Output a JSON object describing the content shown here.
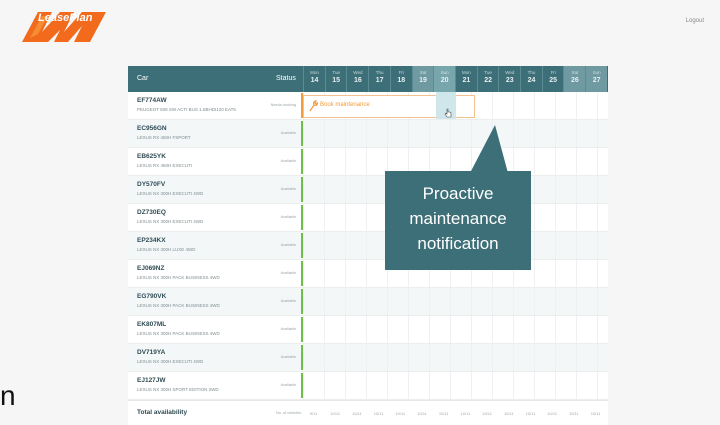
{
  "header": {
    "logo_text": "LeasePlan",
    "logout": "Logout"
  },
  "stray_text": "n",
  "table": {
    "car_header": "Car",
    "status_header": "Status",
    "days": [
      {
        "name": "Mon",
        "date": "14",
        "type": "weekday"
      },
      {
        "name": "Tue",
        "date": "15",
        "type": "weekday"
      },
      {
        "name": "Wed",
        "date": "16",
        "type": "weekday"
      },
      {
        "name": "Thu",
        "date": "17",
        "type": "weekday"
      },
      {
        "name": "Fri",
        "date": "18",
        "type": "weekday"
      },
      {
        "name": "Sat",
        "date": "19",
        "type": "weekend"
      },
      {
        "name": "Sun",
        "date": "20",
        "type": "today"
      },
      {
        "name": "Mon",
        "date": "21",
        "type": "weekday"
      },
      {
        "name": "Tue",
        "date": "22",
        "type": "weekday"
      },
      {
        "name": "Wed",
        "date": "23",
        "type": "weekday"
      },
      {
        "name": "Thu",
        "date": "24",
        "type": "weekday"
      },
      {
        "name": "Fri",
        "date": "25",
        "type": "weekday"
      },
      {
        "name": "Sat",
        "date": "26",
        "type": "weekend"
      },
      {
        "name": "Sun",
        "date": "27",
        "type": "weekend"
      }
    ],
    "rows": [
      {
        "plate": "EF774AW",
        "model": "PEUGEOT 508 SW ACTI BUS 1.6BHDI120 EAT6",
        "status": "Needs booking",
        "bar": "orange"
      },
      {
        "plate": "EC956GN",
        "model": "LEXUS RX 450H FSPORT",
        "status": "Available",
        "bar": "green"
      },
      {
        "plate": "EB625YK",
        "model": "LEXUS RX 450H EXECUTI",
        "status": "Available",
        "bar": "green"
      },
      {
        "plate": "DY570FV",
        "model": "LEXUS NX 300H EXECUTI 4WD",
        "status": "Available",
        "bar": "green"
      },
      {
        "plate": "DZ730EQ",
        "model": "LEXUS NX 300H EXECUTI 4WD",
        "status": "Available",
        "bar": "green"
      },
      {
        "plate": "EP234KX",
        "model": "LEXUS NX 300H LUXE 4WD",
        "status": "Available",
        "bar": "green"
      },
      {
        "plate": "EJ069NZ",
        "model": "LEXUS NX 300H PACK BUSINESS 4WD",
        "status": "Available",
        "bar": "green"
      },
      {
        "plate": "EG790VK",
        "model": "LEXUS NX 300H PACK BUSINESS 4WD",
        "status": "Available",
        "bar": "green"
      },
      {
        "plate": "EK807ML",
        "model": "LEXUS NX 300H PACK BUSINESS 4WD",
        "status": "Available",
        "bar": "green"
      },
      {
        "plate": "DV719YA",
        "model": "LEXUS NX 300H EXECUTI 4WD",
        "status": "Available",
        "bar": "green"
      },
      {
        "plate": "EJ127JW",
        "model": "LEXUS NX 300H SPORT EDITION 2WD",
        "status": "Available",
        "bar": "green"
      }
    ],
    "booking_label": "Book maintenance",
    "total_label": "Total availability",
    "total_sub": "No. of vehicles",
    "total_values": [
      "9/11",
      "10/11",
      "10/11",
      "10/11",
      "10/11",
      "10/11",
      "10/11",
      "10/11",
      "10/11",
      "10/11",
      "10/11",
      "10/11",
      "10/11",
      "10/11"
    ]
  },
  "callout": {
    "lines": [
      "Proactive",
      "maintenance",
      "notification"
    ]
  },
  "colors": {
    "header": "#3d6f78",
    "accent": "#f39c3b",
    "available": "#6ebf4a",
    "logo": "#f26b1d"
  }
}
